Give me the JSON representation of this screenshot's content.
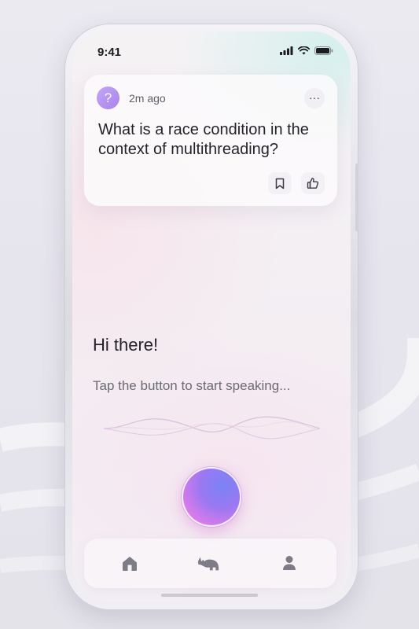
{
  "status_bar": {
    "time": "9:41"
  },
  "question_card": {
    "avatar_symbol": "?",
    "time_ago": "2m ago",
    "more_label": "···",
    "question": "What is a race condition in the context of multithreading?",
    "avatar_color": "#b494f1"
  },
  "voice": {
    "greeting": "Hi there!",
    "hint": "Tap the button to start speaking..."
  },
  "tab_bar": {
    "tabs": [
      {
        "name": "home",
        "icon": "home-icon"
      },
      {
        "name": "assistant",
        "icon": "rhino-icon"
      },
      {
        "name": "profile",
        "icon": "user-icon"
      }
    ]
  },
  "colors": {
    "text_primary": "#24232b",
    "text_secondary": "#6b6a73",
    "icon_gray": "#7c7b86",
    "mic_gradient_start": "#7a83f6",
    "mic_gradient_end": "#f08ad9"
  }
}
